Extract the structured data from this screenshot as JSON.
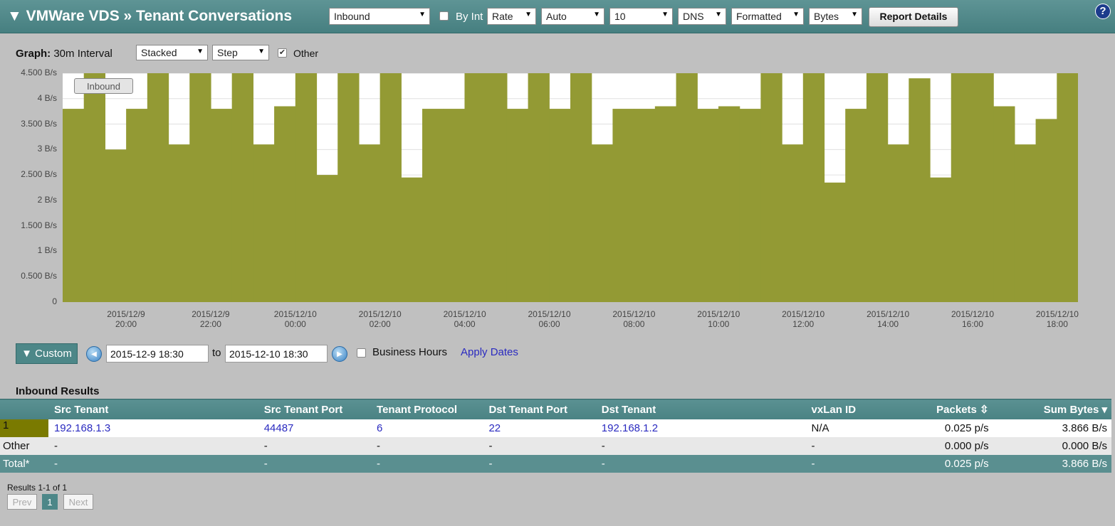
{
  "header": {
    "title": "▼ VMWare VDS » Tenant Conversations",
    "direction_select": "Inbound",
    "by_int_label": "By Int",
    "rate_select": "Rate",
    "auto_select": "Auto",
    "count_select": "10",
    "dns_select": "DNS",
    "format_select": "Formatted",
    "unit_select": "Bytes",
    "report_button": "Report Details",
    "help": "?"
  },
  "graph_controls": {
    "graph_label": "Graph:",
    "interval": "30m Interval",
    "mode_select": "Stacked",
    "style_select": "Step",
    "other_label": "Other",
    "other_checked": true
  },
  "chart_data": {
    "type": "area",
    "step": true,
    "stacked": true,
    "legend_label": "Inbound",
    "y_ticks": [
      "4.500 B/s",
      "4 B/s",
      "3.500 B/s",
      "3 B/s",
      "2.500 B/s",
      "2 B/s",
      "1.500 B/s",
      "1 B/s",
      "0.500 B/s",
      "0"
    ],
    "ylim": [
      0,
      4.5
    ],
    "x_ticks": [
      [
        "2015/12/9",
        "20:00"
      ],
      [
        "2015/12/9",
        "22:00"
      ],
      [
        "2015/12/10",
        "00:00"
      ],
      [
        "2015/12/10",
        "02:00"
      ],
      [
        "2015/12/10",
        "04:00"
      ],
      [
        "2015/12/10",
        "06:00"
      ],
      [
        "2015/12/10",
        "08:00"
      ],
      [
        "2015/12/10",
        "10:00"
      ],
      [
        "2015/12/10",
        "12:00"
      ],
      [
        "2015/12/10",
        "14:00"
      ],
      [
        "2015/12/10",
        "16:00"
      ],
      [
        "2015/12/10",
        "18:00"
      ]
    ],
    "series": [
      {
        "name": "Inbound",
        "color": "#939a34",
        "values": [
          3.8,
          4.5,
          3.0,
          3.8,
          4.5,
          3.1,
          4.5,
          3.8,
          4.5,
          3.1,
          3.85,
          4.5,
          2.5,
          4.5,
          3.1,
          4.5,
          2.45,
          3.8,
          3.8,
          4.5,
          4.5,
          3.8,
          4.5,
          3.8,
          4.5,
          3.1,
          3.8,
          3.8,
          3.85,
          4.5,
          3.8,
          3.85,
          3.8,
          4.5,
          3.1,
          4.5,
          2.35,
          3.8,
          4.5,
          3.1,
          4.4,
          2.45,
          4.5,
          4.5,
          3.85,
          3.1,
          3.6,
          4.5
        ]
      }
    ]
  },
  "date_controls": {
    "custom_button": "▼ Custom",
    "prev_icon": "◀",
    "start": "2015-12-9 18:30",
    "to_label": "to",
    "end": "2015-12-10 18:30",
    "next_icon": "▶",
    "business_hours": "Business Hours",
    "apply": "Apply Dates"
  },
  "results": {
    "title": "Inbound Results",
    "columns": [
      "Src Tenant",
      "Src Tenant Port",
      "Tenant Protocol",
      "Dst Tenant Port",
      "Dst Tenant",
      "vxLan ID",
      "Packets",
      "Sum Bytes"
    ],
    "rows": [
      {
        "rank": "1",
        "src": "192.168.1.3",
        "src_port": "44487",
        "protocol": "6",
        "dst_port": "22",
        "dst": "192.168.1.2",
        "vxlan": "N/A",
        "packets": "0.025 p/s",
        "bytes": "3.866 B/s"
      },
      {
        "rank": "Other",
        "src": "-",
        "src_port": "-",
        "protocol": "-",
        "dst_port": "-",
        "dst": "-",
        "vxlan": "-",
        "packets": "0.000 p/s",
        "bytes": "0.000 B/s"
      },
      {
        "rank": "Total*",
        "src": "-",
        "src_port": "-",
        "protocol": "-",
        "dst_port": "-",
        "dst": "-",
        "vxlan": "-",
        "packets": "0.025 p/s",
        "bytes": "3.866 B/s"
      }
    ],
    "swatch_color": "#7a7a00"
  },
  "pagination": {
    "summary": "Results 1-1 of 1",
    "prev": "Prev",
    "page": "1",
    "next": "Next"
  }
}
